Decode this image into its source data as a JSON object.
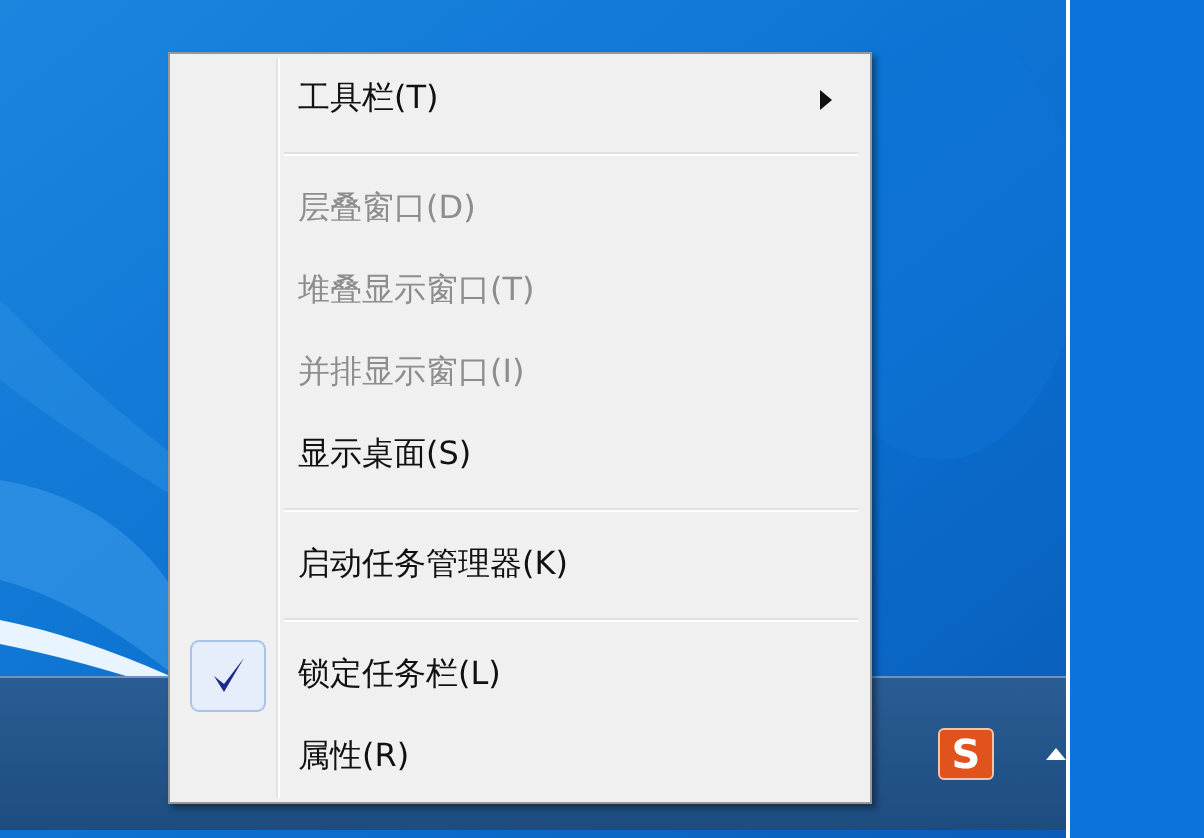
{
  "context_menu": {
    "items": [
      {
        "kind": "item",
        "label": "工具栏(T)",
        "disabled": false,
        "checked": false,
        "submenu": true
      },
      {
        "kind": "separator"
      },
      {
        "kind": "item",
        "label": "层叠窗口(D)",
        "disabled": true,
        "checked": false,
        "submenu": false
      },
      {
        "kind": "item",
        "label": "堆叠显示窗口(T)",
        "disabled": true,
        "checked": false,
        "submenu": false
      },
      {
        "kind": "item",
        "label": "并排显示窗口(I)",
        "disabled": true,
        "checked": false,
        "submenu": false
      },
      {
        "kind": "item",
        "label": "显示桌面(S)",
        "disabled": false,
        "checked": false,
        "submenu": false
      },
      {
        "kind": "separator"
      },
      {
        "kind": "item",
        "label": "启动任务管理器(K)",
        "disabled": false,
        "checked": false,
        "submenu": false
      },
      {
        "kind": "separator"
      },
      {
        "kind": "item",
        "label": "锁定任务栏(L)",
        "disabled": false,
        "checked": true,
        "submenu": false
      },
      {
        "kind": "item",
        "label": "属性(R)",
        "disabled": false,
        "checked": false,
        "submenu": false
      }
    ]
  },
  "taskbar": {
    "tray_icon_text": "S"
  }
}
